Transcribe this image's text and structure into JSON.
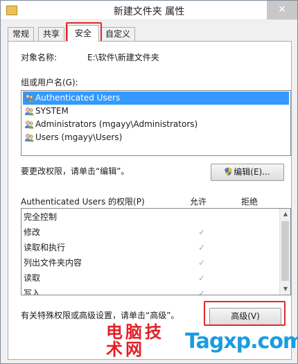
{
  "window": {
    "title": "新建文件夹 属性",
    "close_glyph": "✕"
  },
  "tabs": [
    {
      "label": "常规"
    },
    {
      "label": "共享"
    },
    {
      "label": "安全"
    },
    {
      "label": "自定义"
    }
  ],
  "object": {
    "label": "对象名称:",
    "value": "E:\\软件\\新建文件夹"
  },
  "groups": {
    "label": "组或用户名(G):",
    "items": [
      {
        "name": "Authenticated Users",
        "icon": "user-group-icon"
      },
      {
        "name": "SYSTEM",
        "icon": "user-group-icon"
      },
      {
        "name": "Administrators (mgayy\\Administrators)",
        "icon": "user-group-icon"
      },
      {
        "name": "Users (mgayy\\Users)",
        "icon": "user-group-icon"
      }
    ]
  },
  "edit": {
    "hint": "要更改权限，请单击“编辑”。",
    "button_label": "编辑(E)..."
  },
  "permissions": {
    "title": "Authenticated Users 的权限(P)",
    "allow_header": "允许",
    "deny_header": "拒绝",
    "rows": [
      {
        "name": "完全控制",
        "allow": ""
      },
      {
        "name": "修改",
        "allow": "✓"
      },
      {
        "name": "读取和执行",
        "allow": "✓"
      },
      {
        "name": "列出文件夹内容",
        "allow": "✓"
      },
      {
        "name": "读取",
        "allow": "✓"
      },
      {
        "name": "写入",
        "allow": "✓"
      }
    ]
  },
  "advanced": {
    "hint": "有关特殊权限或高级设置，请单击“高级”。",
    "button_label": "高级(V)"
  },
  "watermark": {
    "cn_text": "电脑技术网",
    "en_text": "Tagxp.com"
  },
  "colors": {
    "selection": "#3399ff",
    "highlight_border": "#e0282c",
    "watermark_red": "#e21f26",
    "watermark_blue": "#1a9ce0"
  }
}
